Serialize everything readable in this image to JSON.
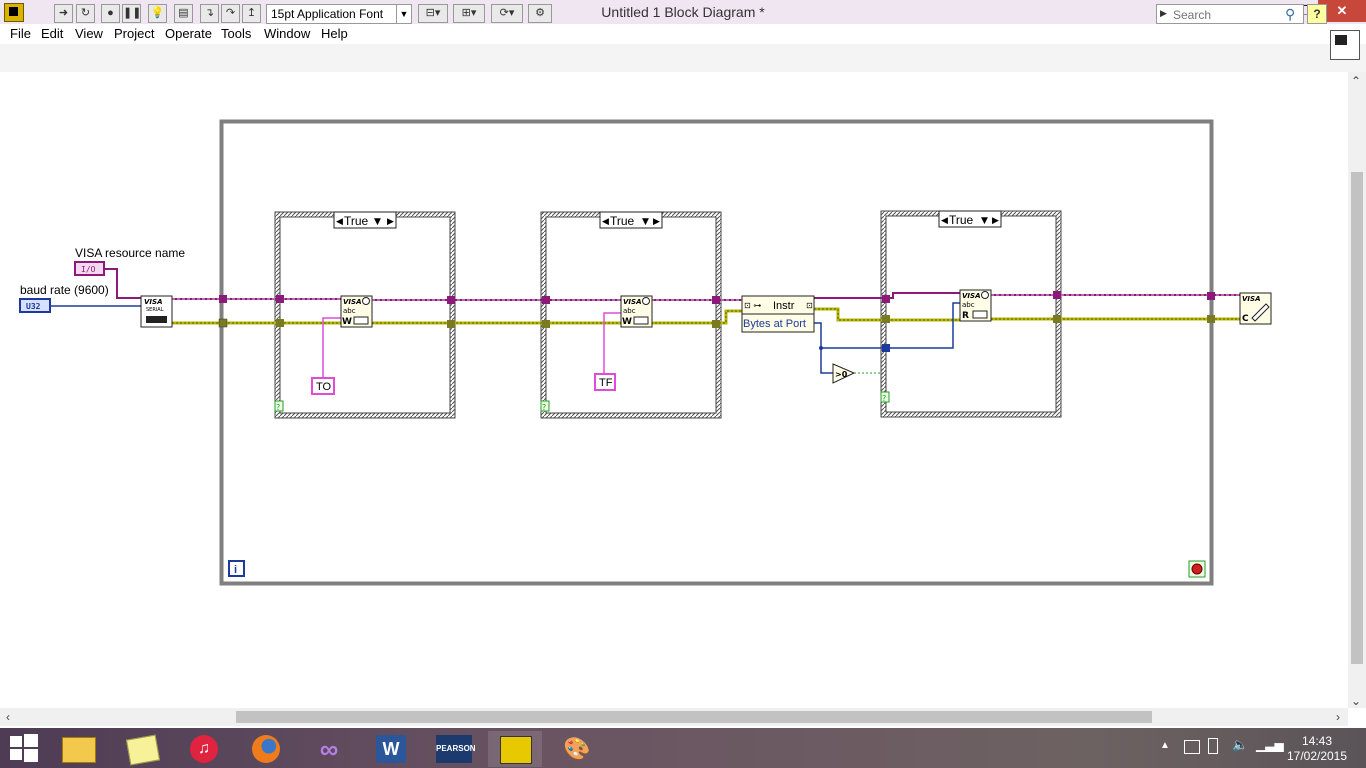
{
  "window": {
    "title": "Untitled 1 Block Diagram *"
  },
  "title_buttons": {
    "minimize": "–",
    "restore": "❐",
    "close": "✕"
  },
  "menu": [
    "File",
    "Edit",
    "View",
    "Project",
    "Operate",
    "Tools",
    "Window",
    "Help"
  ],
  "toolbar": {
    "font": "15pt Application Font",
    "search_placeholder": "Search",
    "help": "?"
  },
  "diagram": {
    "labels": {
      "visa_resource_name": "VISA resource name",
      "baud_rate": "baud rate (9600)"
    },
    "constants": {
      "io_terminal": "I/O",
      "u32_terminal": "U32",
      "to_string": "TO",
      "tf_string": "TF"
    },
    "case_selectors": [
      "True",
      "True",
      "True"
    ],
    "property_node": {
      "class": "Instr",
      "property": "Bytes at Port"
    },
    "nodes": {
      "visa_serial": "VISA",
      "visa_serial_sub": "SERIAL",
      "visa_write": "VISA",
      "visa_read": "VISA",
      "visa_close": "VISA"
    },
    "comparison": ">0",
    "loop_index": "i",
    "case_terminal": "?"
  },
  "taskbar": {
    "apps": [
      "File Explorer",
      "Sticky Notes",
      "iTunes",
      "Firefox",
      "Visual Studio",
      "Word",
      "Pearson Longman",
      "LabVIEW",
      "Paint"
    ],
    "time": "14:43",
    "date": "17/02/2015"
  },
  "colors": {
    "visa_wire": "#8c1a78",
    "error_wire": "#b6b600",
    "u32_wire": "#1c3a9e",
    "string_wire": "#e04cd8",
    "structure_border": "#7f7f7f",
    "close_button": "#c7473a"
  }
}
